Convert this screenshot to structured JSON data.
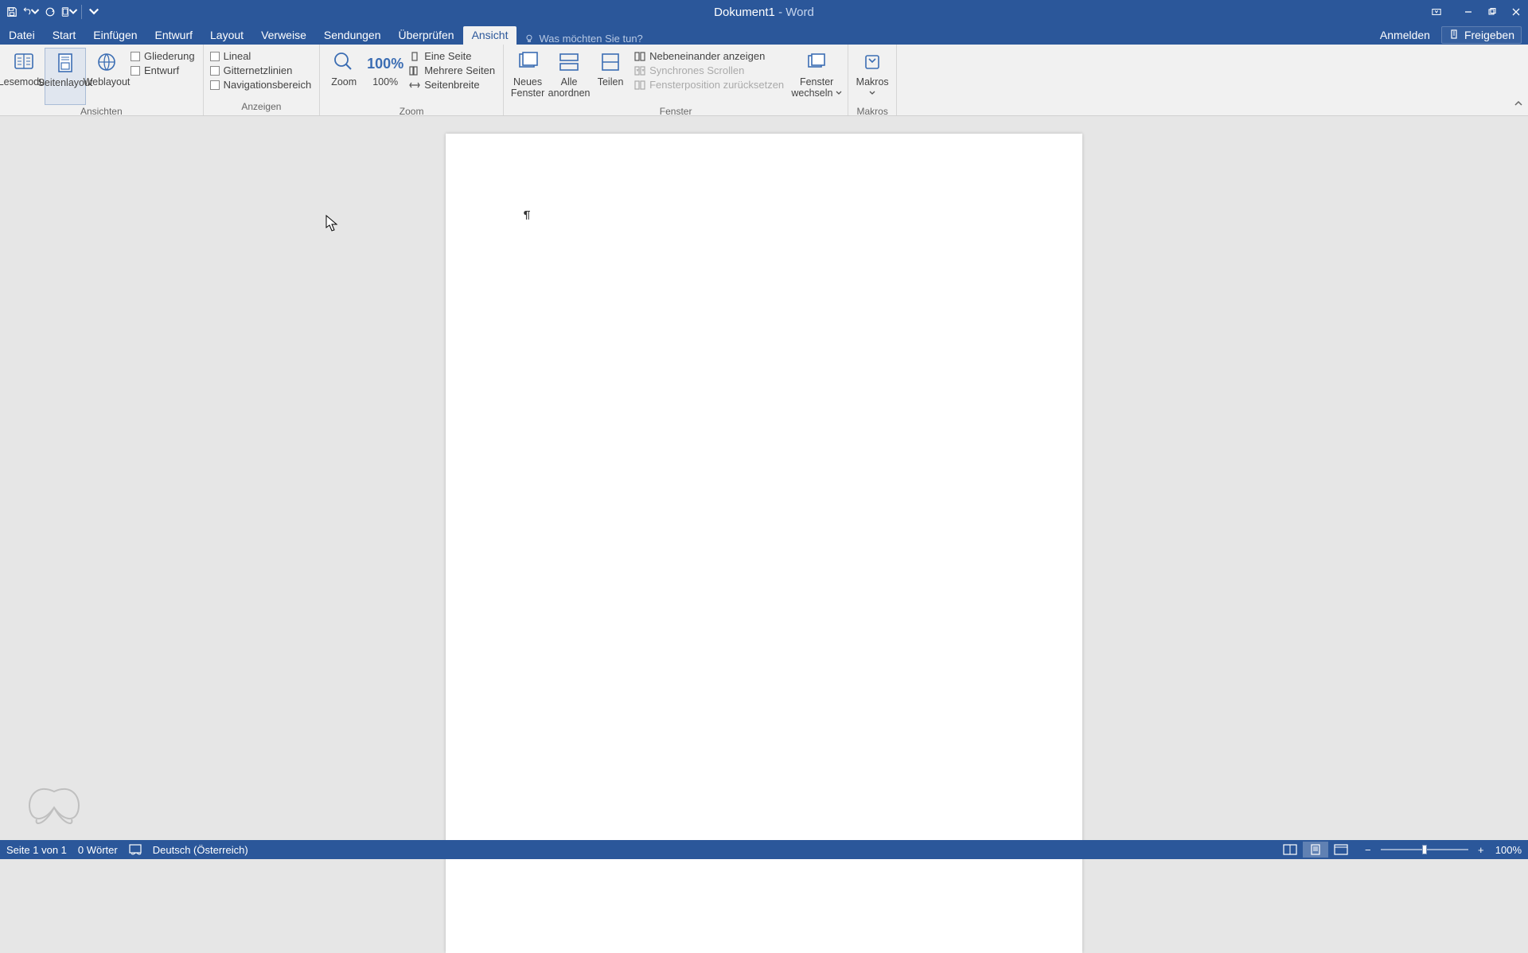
{
  "titlebar": {
    "doc_name": "Dokument1",
    "app_name": "Word"
  },
  "qat": {
    "save": "save-icon",
    "undo": "undo-icon",
    "redo": "redo-icon",
    "touch": "touch-mode-icon",
    "customize": "customize-icon"
  },
  "tabs": {
    "datei": "Datei",
    "start": "Start",
    "einfuegen": "Einfügen",
    "entwurf": "Entwurf",
    "layout": "Layout",
    "verweise": "Verweise",
    "sendungen": "Sendungen",
    "ueberpruefen": "Überprüfen",
    "ansicht": "Ansicht"
  },
  "tellme_placeholder": "Was möchten Sie tun?",
  "account": {
    "label": "Anmelden"
  },
  "share": {
    "label": "Freigeben"
  },
  "ribbon": {
    "groups": {
      "ansichten": {
        "label": "Ansichten",
        "lesemodus": "Lesemodus",
        "seitenlayout": "Seitenlayout",
        "weblayout": "Weblayout",
        "gliederung": "Gliederung",
        "entwurf": "Entwurf"
      },
      "anzeigen": {
        "label": "Anzeigen",
        "lineal": "Lineal",
        "gitternetz": "Gitternetzlinien",
        "navigation": "Navigationsbereich"
      },
      "zoom": {
        "label": "Zoom",
        "zoom_btn": "Zoom",
        "hundred": "100%",
        "eine_seite": "Eine Seite",
        "mehrere_seiten": "Mehrere Seiten",
        "seitenbreite": "Seitenbreite"
      },
      "fenster": {
        "label": "Fenster",
        "neues_fenster": "Neues Fenster",
        "alle_anordnen": "Alle anordnen",
        "teilen": "Teilen",
        "nebeneinander": "Nebeneinander anzeigen",
        "synchron": "Synchrones Scrollen",
        "position": "Fensterposition zurücksetzen",
        "wechseln": "Fenster wechseln"
      },
      "makros": {
        "label": "Makros",
        "btn": "Makros"
      }
    }
  },
  "statusbar": {
    "page": "Seite 1 von 1",
    "words": "0 Wörter",
    "language": "Deutsch (Österreich)",
    "zoom": "100%"
  }
}
